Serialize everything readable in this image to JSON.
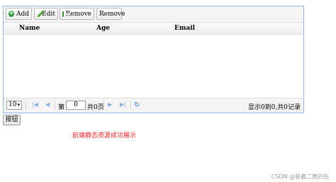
{
  "toolbar": {
    "add_label": "Add",
    "edit_label": "Edit",
    "remove_icon_label": "Remove",
    "remove_label": "Remove"
  },
  "table": {
    "columns": [
      "Name",
      "Age",
      "Email"
    ],
    "rows": []
  },
  "pager": {
    "page_size": "10",
    "page_prefix": "第",
    "page_value": "0",
    "page_suffix": "共0页",
    "info": "显示0到0,共0记录"
  },
  "button_label": "按钮",
  "success_message": "前端静态资源成功展示",
  "watermark": "CSDN @装着二筒的包",
  "colors": {
    "border": "#95b8e7",
    "success_text": "#e8262a",
    "add_icon": "#2e9a3a"
  }
}
